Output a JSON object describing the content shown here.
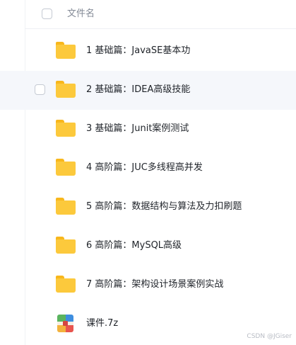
{
  "header": {
    "name_column": "文件名"
  },
  "files": [
    {
      "name": "1 基础篇：JavaSE基本功",
      "icon": "folder-icon"
    },
    {
      "name": "2 基础篇：IDEA高级技能",
      "icon": "folder-icon"
    },
    {
      "name": "3 基础篇：Junit案例测试",
      "icon": "folder-icon"
    },
    {
      "name": "4 高阶篇：JUC多线程高并发",
      "icon": "folder-icon"
    },
    {
      "name": "5 高阶篇：数据结构与算法及力扣刷题",
      "icon": "folder-icon"
    },
    {
      "name": "6 高阶篇：MySQL高级",
      "icon": "folder-icon"
    },
    {
      "name": "7 高阶篇：架构设计场景案例实战",
      "icon": "folder-icon"
    },
    {
      "name": "课件.7z",
      "icon": "archive-icon"
    }
  ],
  "watermark": "CSDN @JGiser",
  "colors": {
    "hover_row": "#f5f7fb",
    "folder": "#fcc93c",
    "text": "#1f2329",
    "header_text": "#838a96"
  }
}
